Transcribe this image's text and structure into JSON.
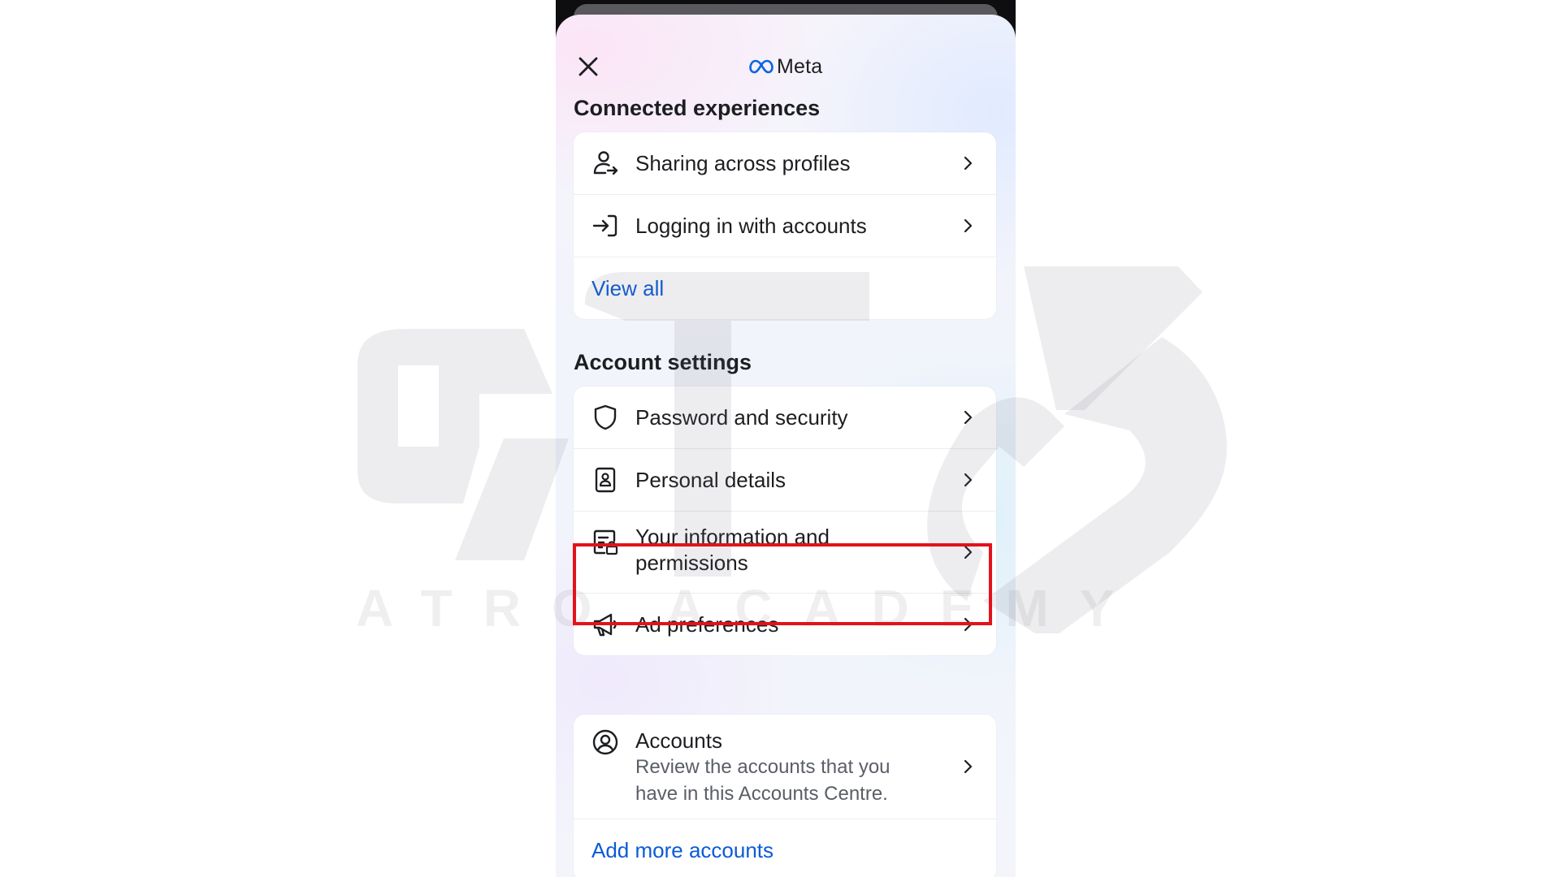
{
  "header": {
    "close_icon": "close-icon",
    "brand": "Meta",
    "brand_color": "#0a66e0"
  },
  "connected": {
    "title": "Connected experiences",
    "items": [
      {
        "label": "Sharing across profiles",
        "icon": "person-share-icon"
      },
      {
        "label": "Logging in with accounts",
        "icon": "login-arrow-icon"
      }
    ],
    "view_all": "View all"
  },
  "account_settings": {
    "title": "Account settings",
    "items": [
      {
        "label": "Password and security",
        "icon": "shield-icon"
      },
      {
        "label": "Personal details",
        "icon": "id-badge-icon"
      },
      {
        "label": "Your information and permissions",
        "icon": "info-lock-icon",
        "highlighted": true
      },
      {
        "label": "Ad preferences",
        "icon": "megaphone-icon"
      }
    ]
  },
  "accounts": {
    "title": "Accounts",
    "description": "Review the accounts that you have in this Accounts Centre.",
    "add_more": "Add more accounts"
  },
  "watermark": {
    "text": "ATRO ACADEMY"
  },
  "colors": {
    "link": "#0a5bd7",
    "highlight": "#e3121b",
    "text": "#1c1e21"
  }
}
